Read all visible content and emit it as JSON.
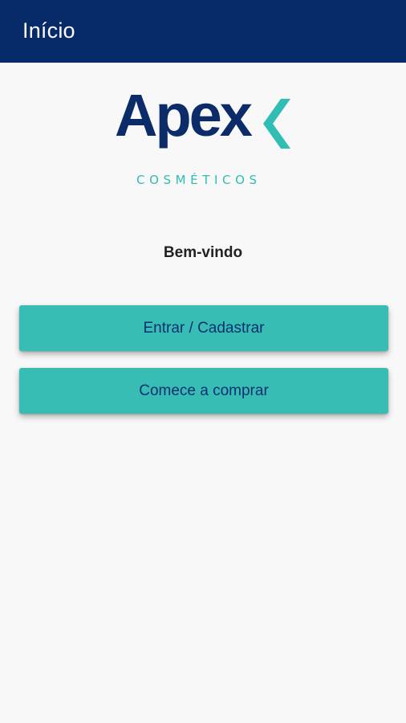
{
  "app_bar": {
    "title": "Início",
    "color": "#072b69"
  },
  "logo": {
    "name": "Apex",
    "subtitle": "COSMÉTICOS",
    "primary_color": "#0c2c69",
    "accent_color": "#30bdb3"
  },
  "welcome_text": "Bem-vindo",
  "buttons": {
    "login_label": "Entrar / Cadastrar",
    "shop_label": "Comece a comprar",
    "color": "#38bdb4",
    "text_color": "#0c3171"
  }
}
